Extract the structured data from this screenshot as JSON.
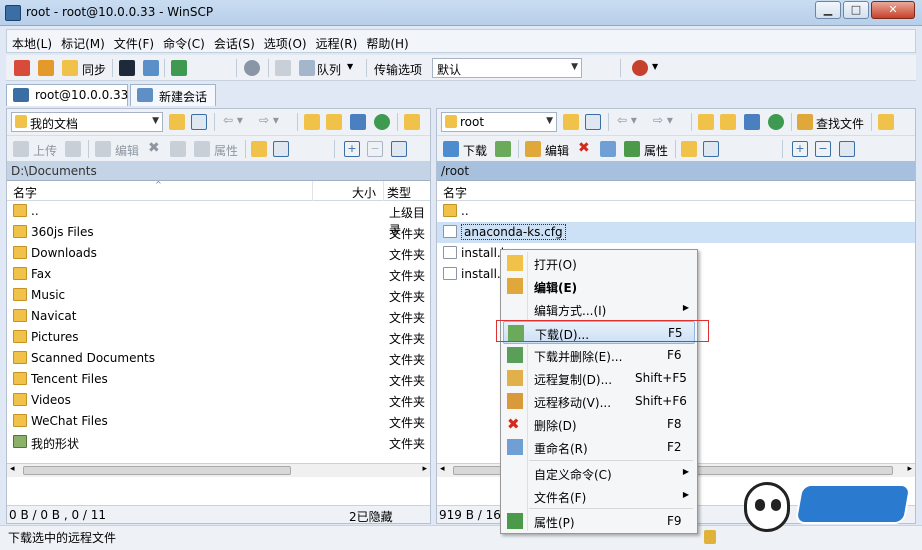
{
  "window": {
    "title": "root - root@10.0.0.33 - WinSCP"
  },
  "menu": [
    "本地(L)",
    "标记(M)",
    "文件(F)",
    "命令(C)",
    "会话(S)",
    "选项(O)",
    "远程(R)",
    "帮助(H)"
  ],
  "toolbar": {
    "sync_label": "同步",
    "queue_label": "队列",
    "transfer_label": "传输选项",
    "transfer_value": "默认"
  },
  "tabs": [
    {
      "label": "root@10.0.0.33"
    },
    {
      "label": "新建会话"
    }
  ],
  "left": {
    "location": "我的文档",
    "actions": {
      "upload": "上传",
      "edit": "编辑",
      "properties": "属性"
    },
    "path": "D:\\Documents",
    "columns": {
      "name": "名字",
      "size": "大小",
      "type": "类型"
    },
    "rows": [
      {
        "name": "..",
        "type": "上级目录"
      },
      {
        "name": "360js Files",
        "type": "文件夹"
      },
      {
        "name": "Downloads",
        "type": "文件夹"
      },
      {
        "name": "Fax",
        "type": "文件夹"
      },
      {
        "name": "Music",
        "type": "文件夹"
      },
      {
        "name": "Navicat",
        "type": "文件夹"
      },
      {
        "name": "Pictures",
        "type": "文件夹"
      },
      {
        "name": "Scanned Documents",
        "type": "文件夹"
      },
      {
        "name": "Tencent Files",
        "type": "文件夹"
      },
      {
        "name": "Videos",
        "type": "文件夹"
      },
      {
        "name": "WeChat Files",
        "type": "文件夹"
      },
      {
        "name": "我的形状",
        "type": "文件夹"
      }
    ],
    "status_left": "0 B / 0 B , 0 / 11",
    "status_right": "2已隐藏"
  },
  "right": {
    "location": "root",
    "find_label": "查找文件",
    "actions": {
      "download": "下载",
      "edit": "编辑",
      "properties": "属性"
    },
    "path": "/root",
    "columns": {
      "name": "名字"
    },
    "rows": [
      {
        "name": ".."
      },
      {
        "name": "anaconda-ks.cfg"
      },
      {
        "name": "install.lo"
      },
      {
        "name": "install.lo"
      }
    ],
    "status_left": "919 B / 16,"
  },
  "status_hint": "下载选中的远程文件",
  "context_menu": [
    {
      "label": "打开(O)",
      "key": "",
      "sub": false
    },
    {
      "label": "编辑(E)",
      "key": "",
      "sub": false
    },
    {
      "label": "编辑方式...(I)",
      "key": "",
      "sub": true
    },
    {
      "label": "下载(D)...",
      "key": "F5",
      "sub": false
    },
    {
      "label": "下载并删除(E)...",
      "key": "F6",
      "sub": false
    },
    {
      "label": "远程复制(D)...",
      "key": "Shift+F5",
      "sub": false
    },
    {
      "label": "远程移动(V)...",
      "key": "Shift+F6",
      "sub": false
    },
    {
      "label": "删除(D)",
      "key": "F8",
      "sub": false
    },
    {
      "label": "重命名(R)",
      "key": "F2",
      "sub": false
    },
    {
      "label": "自定义命令(C)",
      "key": "",
      "sub": true
    },
    {
      "label": "文件名(F)",
      "key": "",
      "sub": true
    },
    {
      "label": "属性(P)",
      "key": "F9",
      "sub": false
    }
  ],
  "colors": {
    "accent": "#3399ff",
    "selection": "#cce0f6",
    "highlight_box": "#e03030"
  }
}
